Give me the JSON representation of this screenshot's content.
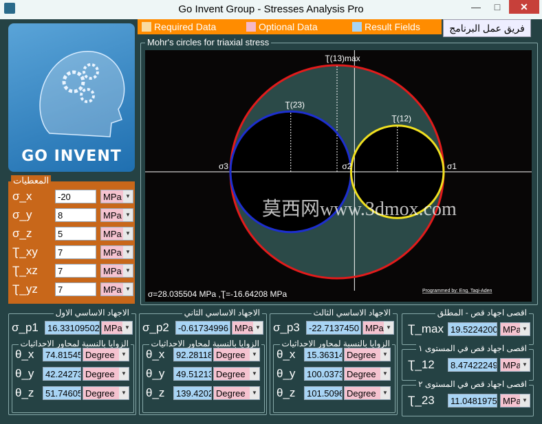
{
  "window": {
    "title": "Go Invent Group - Stresses Analysis Pro",
    "min": "—",
    "max": "□",
    "close": "✕"
  },
  "logo": {
    "brand": "GO INVENT"
  },
  "legend": {
    "required": "Required Data",
    "optional": "Optional  Data",
    "result": "Result Fields",
    "colors": {
      "required": "#f9dba0",
      "optional": "#f5b8c8",
      "result": "#a8d4f4"
    }
  },
  "team_button": "فريق عمل البرنامج",
  "chart": {
    "title": "Mohr's circles for triaxial stress",
    "readout": "σ=28.035504 MPa ,Ʈ=-16.64208 MPa",
    "credit": "Programmed by: Eng. Taqi-Aden",
    "watermark": "莫西网www.3dmox.com"
  },
  "chart_data": {
    "type": "mohr_circles",
    "unit": "MPa",
    "principal": {
      "s1": 16.33109502,
      "s2": -0.61734996,
      "s3": -22.713745
    },
    "labels": {
      "s1": "σ1",
      "s2": "σ2",
      "s3": "σ3",
      "t13": "Ʈ(13)max",
      "t23": "Ʈ(23)",
      "t12": "Ʈ(12)"
    },
    "circles": [
      {
        "name": "13",
        "color": "#e21b1b",
        "center": -3.19132499,
        "radius": 19.52242
      },
      {
        "name": "23",
        "color": "#1d2fcf",
        "center": -11.66554748,
        "radius": 11.0481975
      },
      {
        "name": "12",
        "color": "#f0e020",
        "center": 7.85687253,
        "radius": 8.47422249
      }
    ],
    "cursor": {
      "sigma": 28.035504,
      "tau": -16.64208
    }
  },
  "inputs": {
    "title": "المعطيات",
    "rows": [
      {
        "label": "σ_x",
        "value": "-20",
        "unit": "MPa"
      },
      {
        "label": "σ_y",
        "value": "8",
        "unit": "MPa"
      },
      {
        "label": "σ_z",
        "value": "5",
        "unit": "MPa"
      },
      {
        "label": "Ʈ_xy",
        "value": "7",
        "unit": "MPa"
      },
      {
        "label": "Ʈ_xz",
        "value": "7",
        "unit": "MPa"
      },
      {
        "label": "Ʈ_yz",
        "value": "7",
        "unit": "MPa"
      }
    ]
  },
  "principals": [
    {
      "title": "الاجهاد الاساسي الاول",
      "label": "σ_p1",
      "value": "16.33109502",
      "unit": "MPa",
      "angles_title": "الزوايا بالنسبة لمحاور الاحداثيات",
      "angles": [
        {
          "label": "θ_x",
          "value": "74.81545",
          "unit": "Degree"
        },
        {
          "label": "θ_y",
          "value": "42.24273",
          "unit": "Degree"
        },
        {
          "label": "θ_z",
          "value": "51.74605",
          "unit": "Degree"
        }
      ]
    },
    {
      "title": "الاجهاد الاساسي الثاني",
      "label": "σ_p2",
      "value": "-0.61734996",
      "unit": "MPa",
      "angles_title": "الزوايا بالنسبة لمحاور الاحداثيات",
      "angles": [
        {
          "label": "θ_x",
          "value": "92.28118",
          "unit": "Degree"
        },
        {
          "label": "θ_y",
          "value": "49.51213",
          "unit": "Degree"
        },
        {
          "label": "θ_z",
          "value": "139.4202",
          "unit": "Degree"
        }
      ]
    },
    {
      "title": "الاجهاد الاساسي الثالث",
      "label": "σ_p3",
      "value": "-22.7137450",
      "unit": "MPa",
      "angles_title": "الزوايا بالنسبة لمحاور الاحداثيات",
      "angles": [
        {
          "label": "θ_x",
          "value": "15.36314",
          "unit": "Degree"
        },
        {
          "label": "θ_y",
          "value": "100.0373",
          "unit": "Degree"
        },
        {
          "label": "θ_z",
          "value": "101.5096",
          "unit": "Degree"
        }
      ]
    }
  ],
  "shear": [
    {
      "title": "اقصى اجهاد قص - المطلق",
      "label": "Ʈ_max",
      "value": "19.5224200",
      "unit": "MPa"
    },
    {
      "title": "اقصى اجهاد قص في المستوى ١",
      "label": "Ʈ_12",
      "value": "8.47422249",
      "unit": "MPa"
    },
    {
      "title": "اقصى اجهاد قص في المستوى ٢",
      "label": "Ʈ_23",
      "value": "11.0481975",
      "unit": "MPa"
    }
  ]
}
